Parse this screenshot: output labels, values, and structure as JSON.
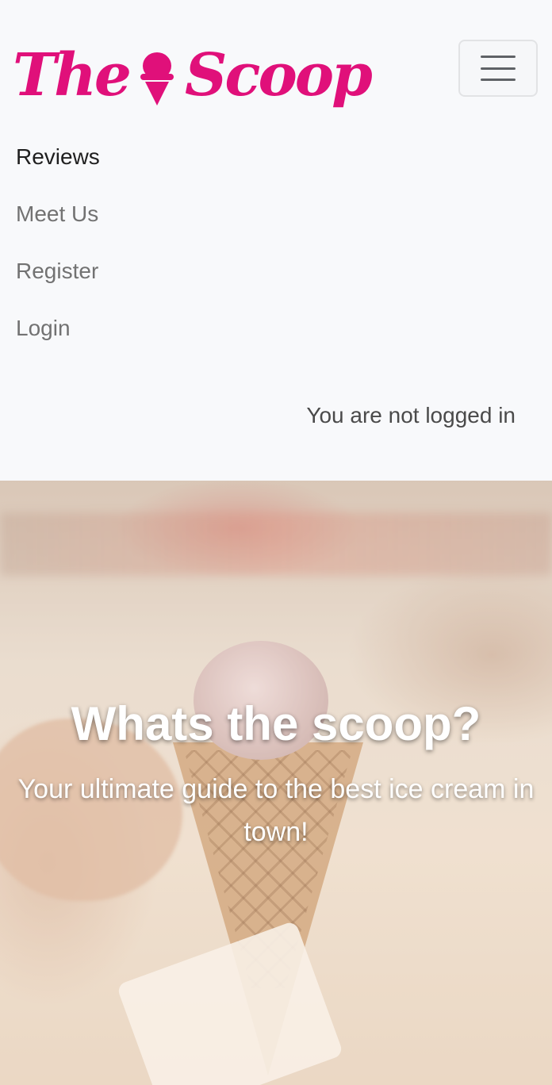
{
  "brand": {
    "word_before": "The",
    "word_after": "Scoop",
    "color": "#e0107a",
    "logo_icon": "ice-cream-cone-icon"
  },
  "navbar": {
    "toggler_icon": "hamburger-menu-icon",
    "items": [
      {
        "label": "Reviews",
        "active": true
      },
      {
        "label": "Meet Us",
        "active": false
      },
      {
        "label": "Register",
        "active": false
      },
      {
        "label": "Login",
        "active": false
      }
    ],
    "login_status": "You are not logged in"
  },
  "hero": {
    "title": "Whats the scoop?",
    "subtitle": "Your ultimate guide to the best ice cream in town!"
  }
}
